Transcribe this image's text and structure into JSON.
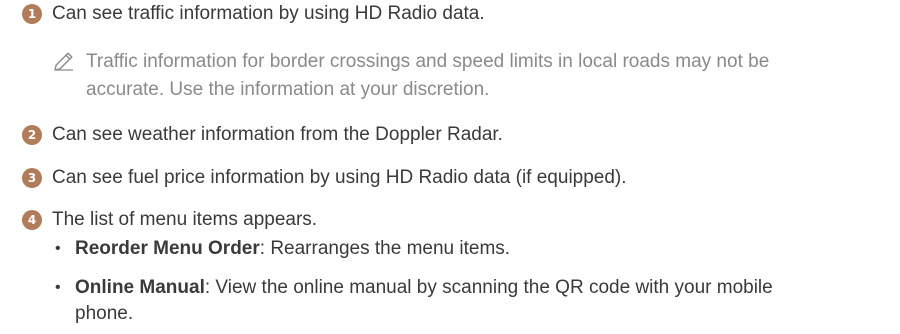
{
  "items": [
    {
      "number": "1",
      "text": "Can see traffic information by using HD Radio data."
    },
    {
      "number": "2",
      "text": "Can see weather information from the Doppler Radar."
    },
    {
      "number": "3",
      "text": "Can see fuel price information by using HD Radio data (if equipped)."
    },
    {
      "number": "4",
      "text": "The list of menu items appears."
    }
  ],
  "note": {
    "icon": "pencil-icon",
    "line1": "Traffic information for border crossings and speed limits in local roads may not be",
    "line2": "accurate. Use the information at your discretion."
  },
  "subitems": [
    {
      "bullet": "•",
      "title": "Reorder Menu Order",
      "desc": ": Rearranges the menu items."
    },
    {
      "bullet": "•",
      "title": "Online Manual",
      "desc_line1": ": View the online manual by scanning the QR code with your mobile",
      "desc_line2": "phone."
    }
  ],
  "colors": {
    "accent": "#b07c5a",
    "body_text": "#3a3a3a",
    "note_text": "#8a8a8a"
  }
}
